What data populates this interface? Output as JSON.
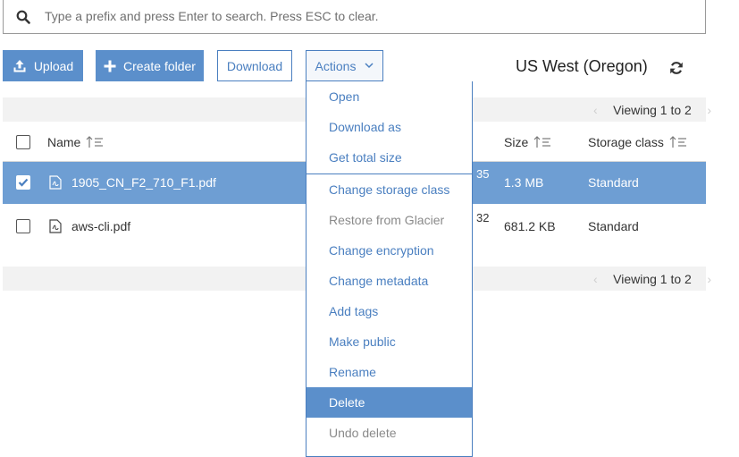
{
  "search": {
    "placeholder": "Type a prefix and press Enter to search. Press ESC to clear."
  },
  "toolbar": {
    "upload_label": "Upload",
    "create_folder_label": "Create folder",
    "download_label": "Download",
    "actions_label": "Actions"
  },
  "region": "US West (Oregon)",
  "pagination": {
    "top": "Viewing 1 to 2",
    "bottom": "Viewing 1 to 2"
  },
  "table": {
    "columns": {
      "name": "Name",
      "size": "Size",
      "storage_class": "Storage class"
    },
    "rows": [
      {
        "name": "1905_CN_F2_710_F1.pdf",
        "modified_fragment": "35",
        "size": "1.3 MB",
        "storage_class": "Standard",
        "selected": true
      },
      {
        "name": "aws-cli.pdf",
        "modified_fragment": "32",
        "size": "681.2 KB",
        "storage_class": "Standard",
        "selected": false
      }
    ]
  },
  "actions_menu": {
    "items": [
      {
        "label": "Open",
        "state": "enabled"
      },
      {
        "label": "Download as",
        "state": "enabled"
      },
      {
        "label": "Get total size",
        "state": "enabled"
      },
      {
        "label": "Change storage class",
        "state": "enabled"
      },
      {
        "label": "Restore from Glacier",
        "state": "disabled"
      },
      {
        "label": "Change encryption",
        "state": "enabled"
      },
      {
        "label": "Change metadata",
        "state": "enabled"
      },
      {
        "label": "Add tags",
        "state": "enabled"
      },
      {
        "label": "Make public",
        "state": "enabled"
      },
      {
        "label": "Rename",
        "state": "enabled"
      },
      {
        "label": "Delete",
        "state": "active"
      },
      {
        "label": "Undo delete",
        "state": "disabled"
      }
    ]
  },
  "colors": {
    "primary": "#5b8fcb",
    "link": "#4a7fc0",
    "selected_row": "#6e9ed3",
    "disabled_text": "#8a8a8a"
  },
  "icons": {
    "search": "search-icon",
    "upload": "upload-icon",
    "create_folder": "plus-icon",
    "actions": "chevron-down-icon",
    "refresh": "refresh-icon",
    "sort": "sort-icon",
    "file": "pdf-file-icon",
    "checkbox": "checkbox"
  }
}
